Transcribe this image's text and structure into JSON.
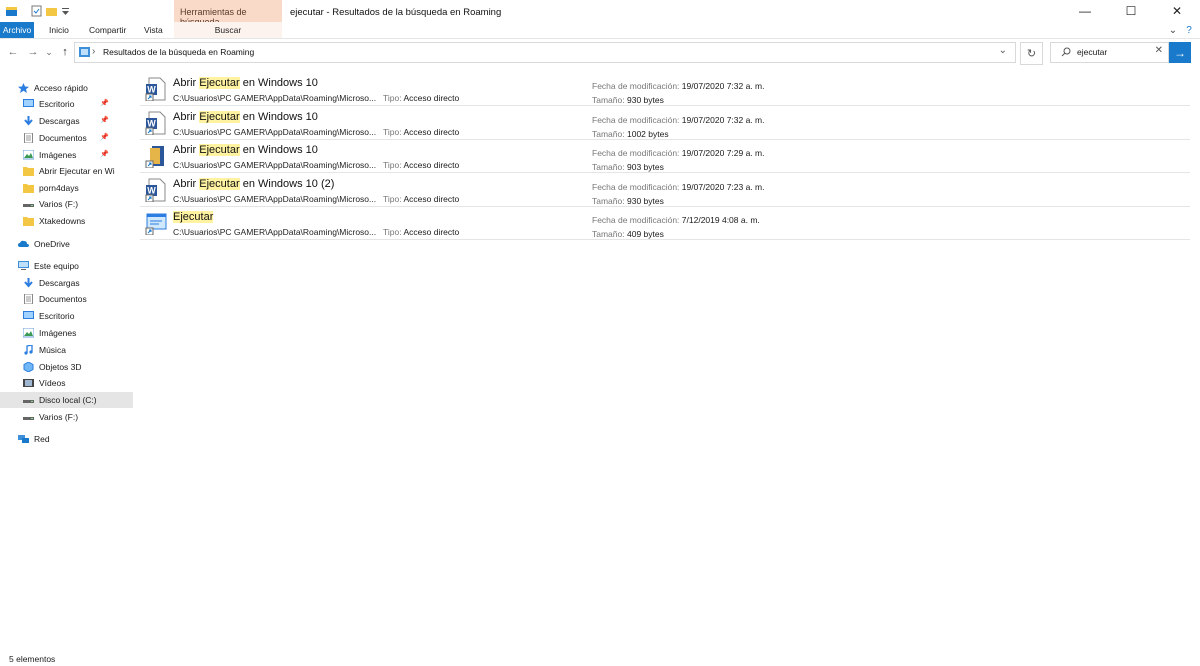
{
  "window": {
    "title": "ejecutar - Resultados de la búsqueda en Roaming",
    "contextual_group": "Herramientas de búsqueda",
    "min": "—",
    "max": "☐",
    "close": "✕"
  },
  "ribbon": {
    "tabs": [
      "Archivo",
      "Inicio",
      "Compartir",
      "Vista",
      "Buscar"
    ],
    "expand": "⌄",
    "help": "?"
  },
  "address": {
    "path": "Resultados de la búsqueda en Roaming",
    "separator": "›",
    "dropdown": "⌄",
    "refresh": "↻"
  },
  "nav": {
    "back": "←",
    "forward": "→",
    "recent": "⌄",
    "up": "↑"
  },
  "search": {
    "value": "ejecutar",
    "clear": "✕",
    "go": "→"
  },
  "sidebar": {
    "items": [
      {
        "label": "Acceso rápido",
        "icon": "star-icon"
      },
      {
        "label": "Escritorio",
        "icon": "desktop-icon",
        "pinned": true
      },
      {
        "label": "Descargas",
        "icon": "download-icon",
        "pinned": true
      },
      {
        "label": "Documentos",
        "icon": "documents-icon",
        "pinned": true
      },
      {
        "label": "Imágenes",
        "icon": "images-icon",
        "pinned": true
      },
      {
        "label": "Abrir Ejecutar en Wi",
        "icon": "folder-icon"
      },
      {
        "label": "porn4days",
        "icon": "folder-icon"
      },
      {
        "label": "Varios (F:)",
        "icon": "drive-icon"
      },
      {
        "label": "Xtakedowns",
        "icon": "folder-icon"
      },
      {
        "label": "OneDrive",
        "icon": "onedrive-icon"
      },
      {
        "label": "Este equipo",
        "icon": "computer-icon"
      },
      {
        "label": "Descargas",
        "icon": "download-icon"
      },
      {
        "label": "Documentos",
        "icon": "documents-icon"
      },
      {
        "label": "Escritorio",
        "icon": "desktop-icon"
      },
      {
        "label": "Imágenes",
        "icon": "images-icon"
      },
      {
        "label": "Música",
        "icon": "music-icon"
      },
      {
        "label": "Objetos 3D",
        "icon": "objects3d-icon"
      },
      {
        "label": "Vídeos",
        "icon": "videos-icon"
      },
      {
        "label": "Disco local (C:)",
        "icon": "drive-icon",
        "selected": true
      },
      {
        "label": "Varios (F:)",
        "icon": "drive-icon"
      },
      {
        "label": "Red",
        "icon": "network-icon"
      }
    ]
  },
  "results": {
    "type_label": "Tipo:",
    "date_label": "Fecha de modificación:",
    "size_label": "Tamaño:",
    "items": [
      {
        "pre": "Abrir ",
        "hl": "Ejecutar",
        "post": " en Windows 10",
        "path": "C:\\Usuarios\\PC GAMER\\AppData\\Roaming\\Microso...",
        "type": "Acceso directo",
        "date": "19/07/2020 7:32 a. m.",
        "size": "930 bytes",
        "icon": "word-shortcut-icon"
      },
      {
        "pre": "Abrir ",
        "hl": "Ejecutar",
        "post": " en Windows 10",
        "path": "C:\\Usuarios\\PC GAMER\\AppData\\Roaming\\Microso...",
        "type": "Acceso directo",
        "date": "19/07/2020 7:32 a. m.",
        "size": "1002 bytes",
        "icon": "word-shortcut-icon"
      },
      {
        "pre": "Abrir ",
        "hl": "Ejecutar",
        "post": " en Windows 10",
        "path": "C:\\Usuarios\\PC GAMER\\AppData\\Roaming\\Microso...",
        "type": "Acceso directo",
        "date": "19/07/2020 7:29 a. m.",
        "size": "903 bytes",
        "icon": "folder-shortcut-icon"
      },
      {
        "pre": "Abrir ",
        "hl": "Ejecutar",
        "post": " en Windows 10 (2)",
        "path": "C:\\Usuarios\\PC GAMER\\AppData\\Roaming\\Microso...",
        "type": "Acceso directo",
        "date": "19/07/2020 7:23 a. m.",
        "size": "930 bytes",
        "icon": "word-shortcut-icon"
      },
      {
        "pre": "",
        "hl": "Ejecutar",
        "post": "",
        "path": "C:\\Usuarios\\PC GAMER\\AppData\\Roaming\\Microso...",
        "type": "Acceso directo",
        "date": "7/12/2019 4:08 a. m.",
        "size": "409 bytes",
        "icon": "run-shortcut-icon"
      }
    ]
  },
  "status": {
    "count": "5 elementos"
  }
}
